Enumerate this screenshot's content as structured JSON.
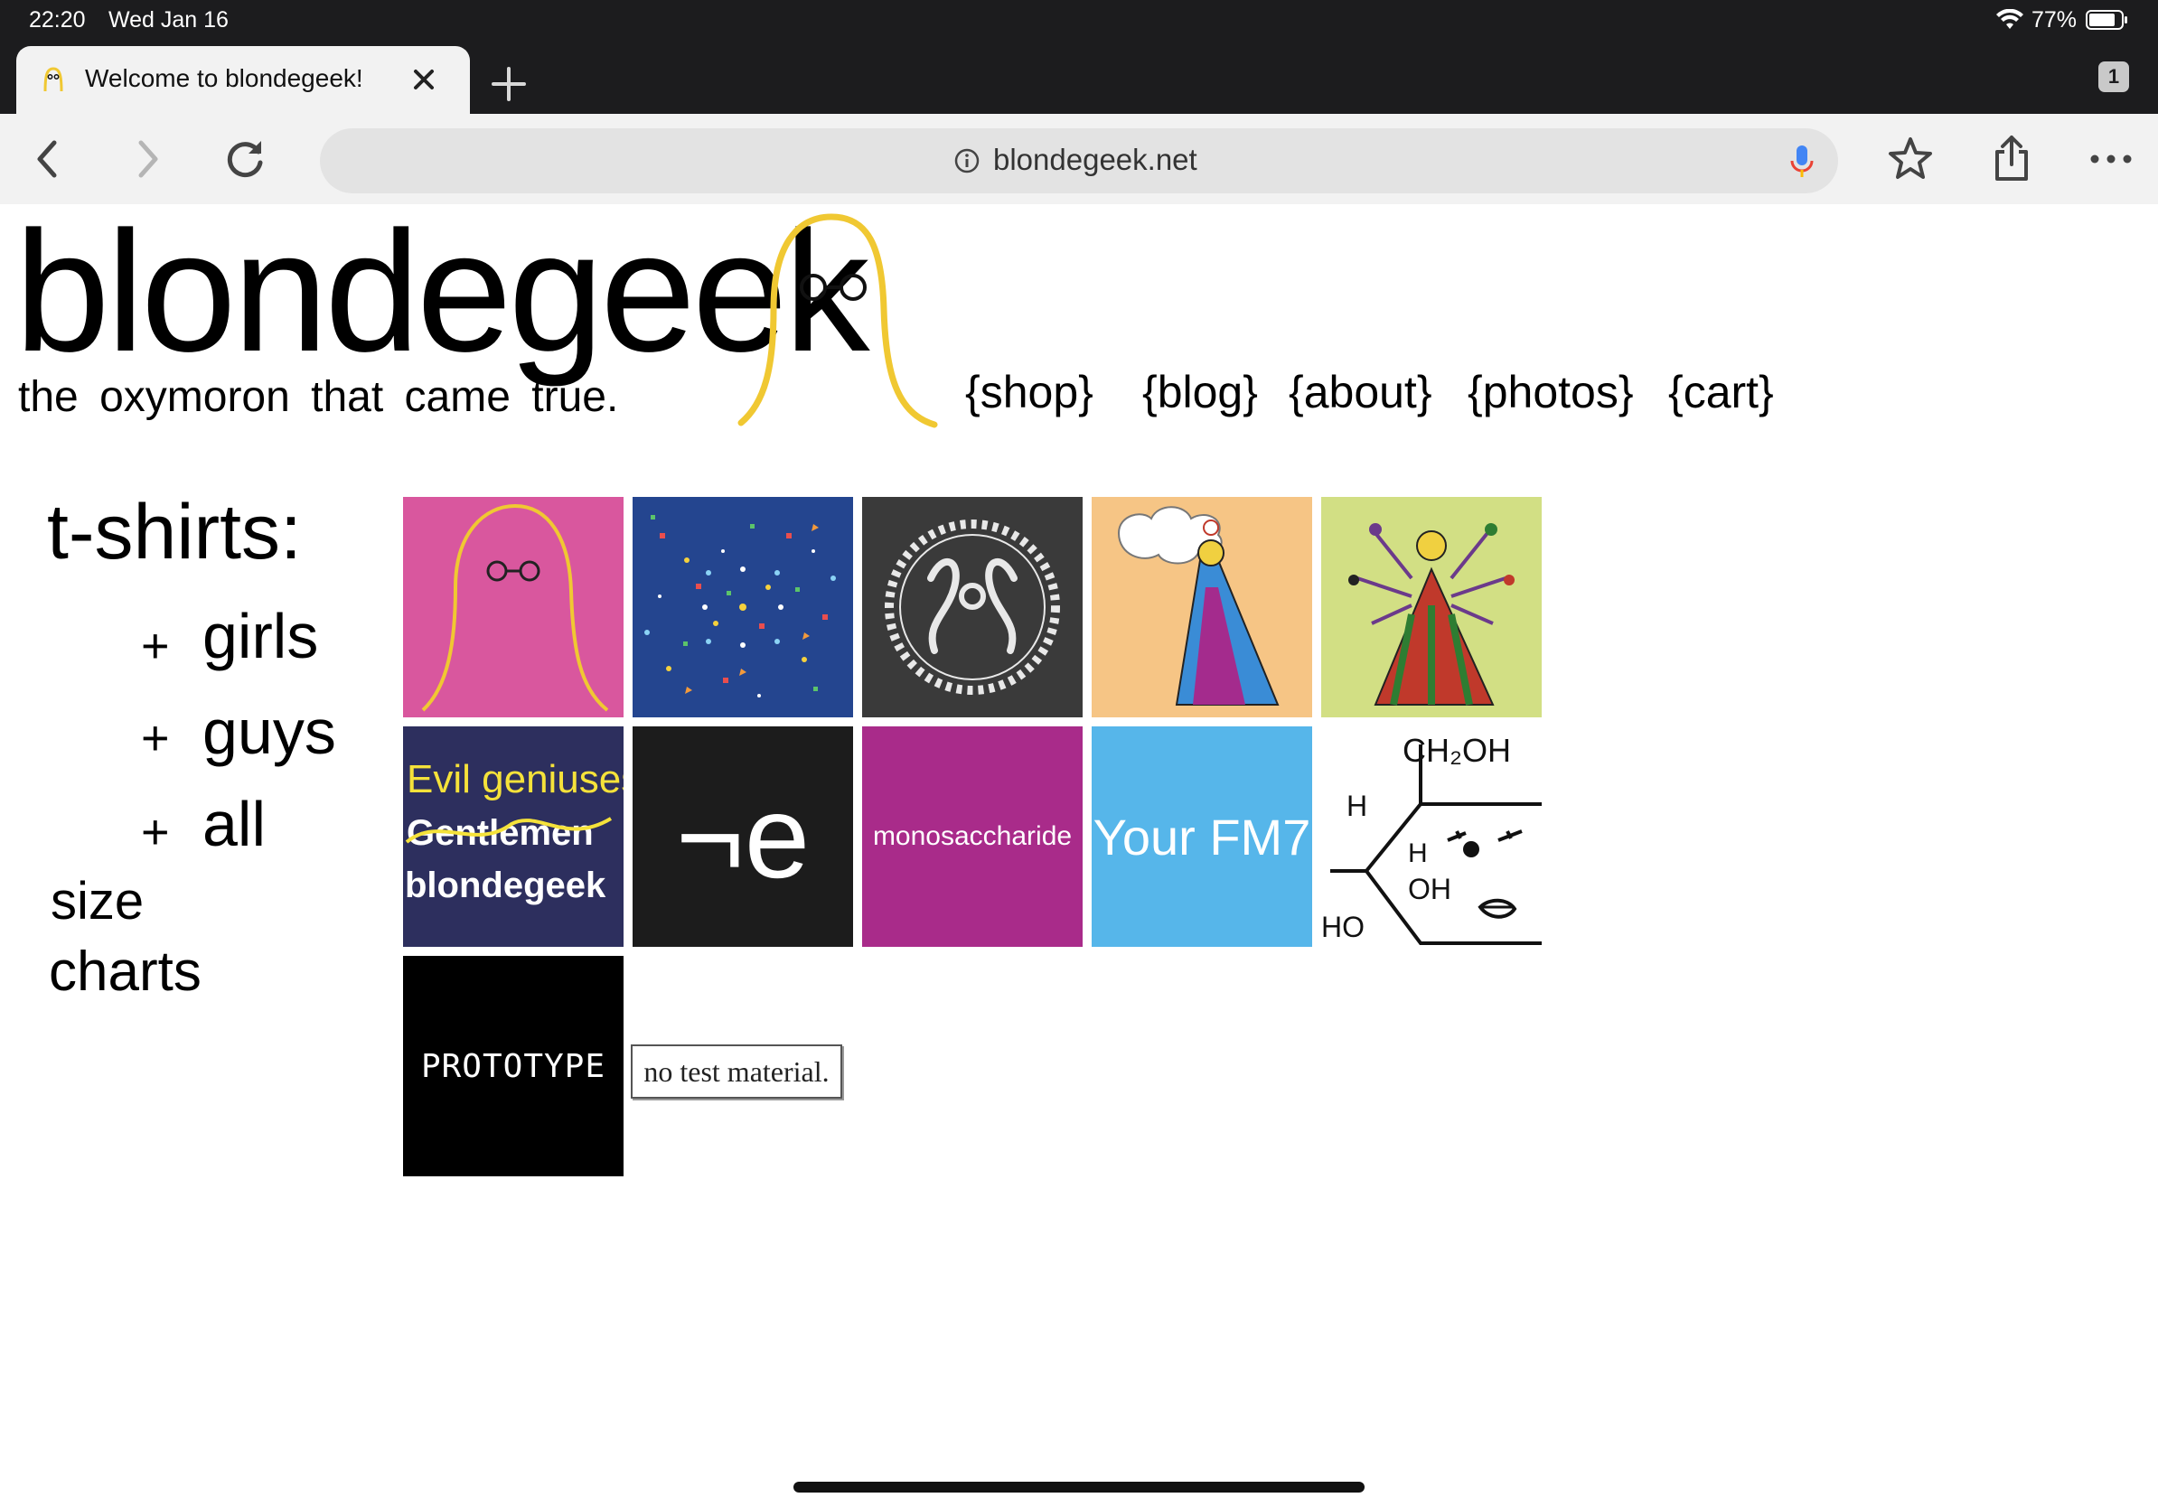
{
  "status_bar": {
    "time": "22:20",
    "date": "Wed Jan 16",
    "battery": "77%"
  },
  "tab": {
    "title": "Welcome to blondegeek!",
    "count": "1"
  },
  "toolbar": {
    "url": "blondegeek.net"
  },
  "header": {
    "logo_wordmark": "blondegeek",
    "tagline": "the oxymoron that came true.",
    "nav": [
      "{shop}",
      "{blog}",
      "{about}",
      "{photos}",
      "{cart}"
    ]
  },
  "sidebar": {
    "heading": "t-shirts:",
    "plus": "+",
    "links": [
      "girls",
      "guys",
      "all"
    ],
    "size_line1": "size",
    "size_line2": "charts"
  },
  "tiles": {
    "evil": {
      "line1": "Evil geniuses",
      "line2": "Gentlemen",
      "line3": "blondegeek"
    },
    "not_e": "¬e",
    "monosaccharide": "monosaccharide",
    "your_fm": "Your FM7",
    "chem": {
      "top": "CH₂OH",
      "h_left": "H",
      "h": "H",
      "oh": "OH",
      "ho": "HO"
    },
    "prototype": "PROTOTYPE",
    "no_test": "no test material."
  },
  "colors": {
    "tile_pink": "#d9579e",
    "tile_blue": "#24458f",
    "tile_dark": "#3a3a3a",
    "tile_peach": "#f6c585",
    "tile_lime": "#d2df84",
    "tile_navy": "#2d2f5e",
    "tile_black": "#1c1c1c",
    "tile_magenta": "#a92b8a",
    "tile_sky": "#56b6ea",
    "logo_yellow": "#f0c832"
  }
}
